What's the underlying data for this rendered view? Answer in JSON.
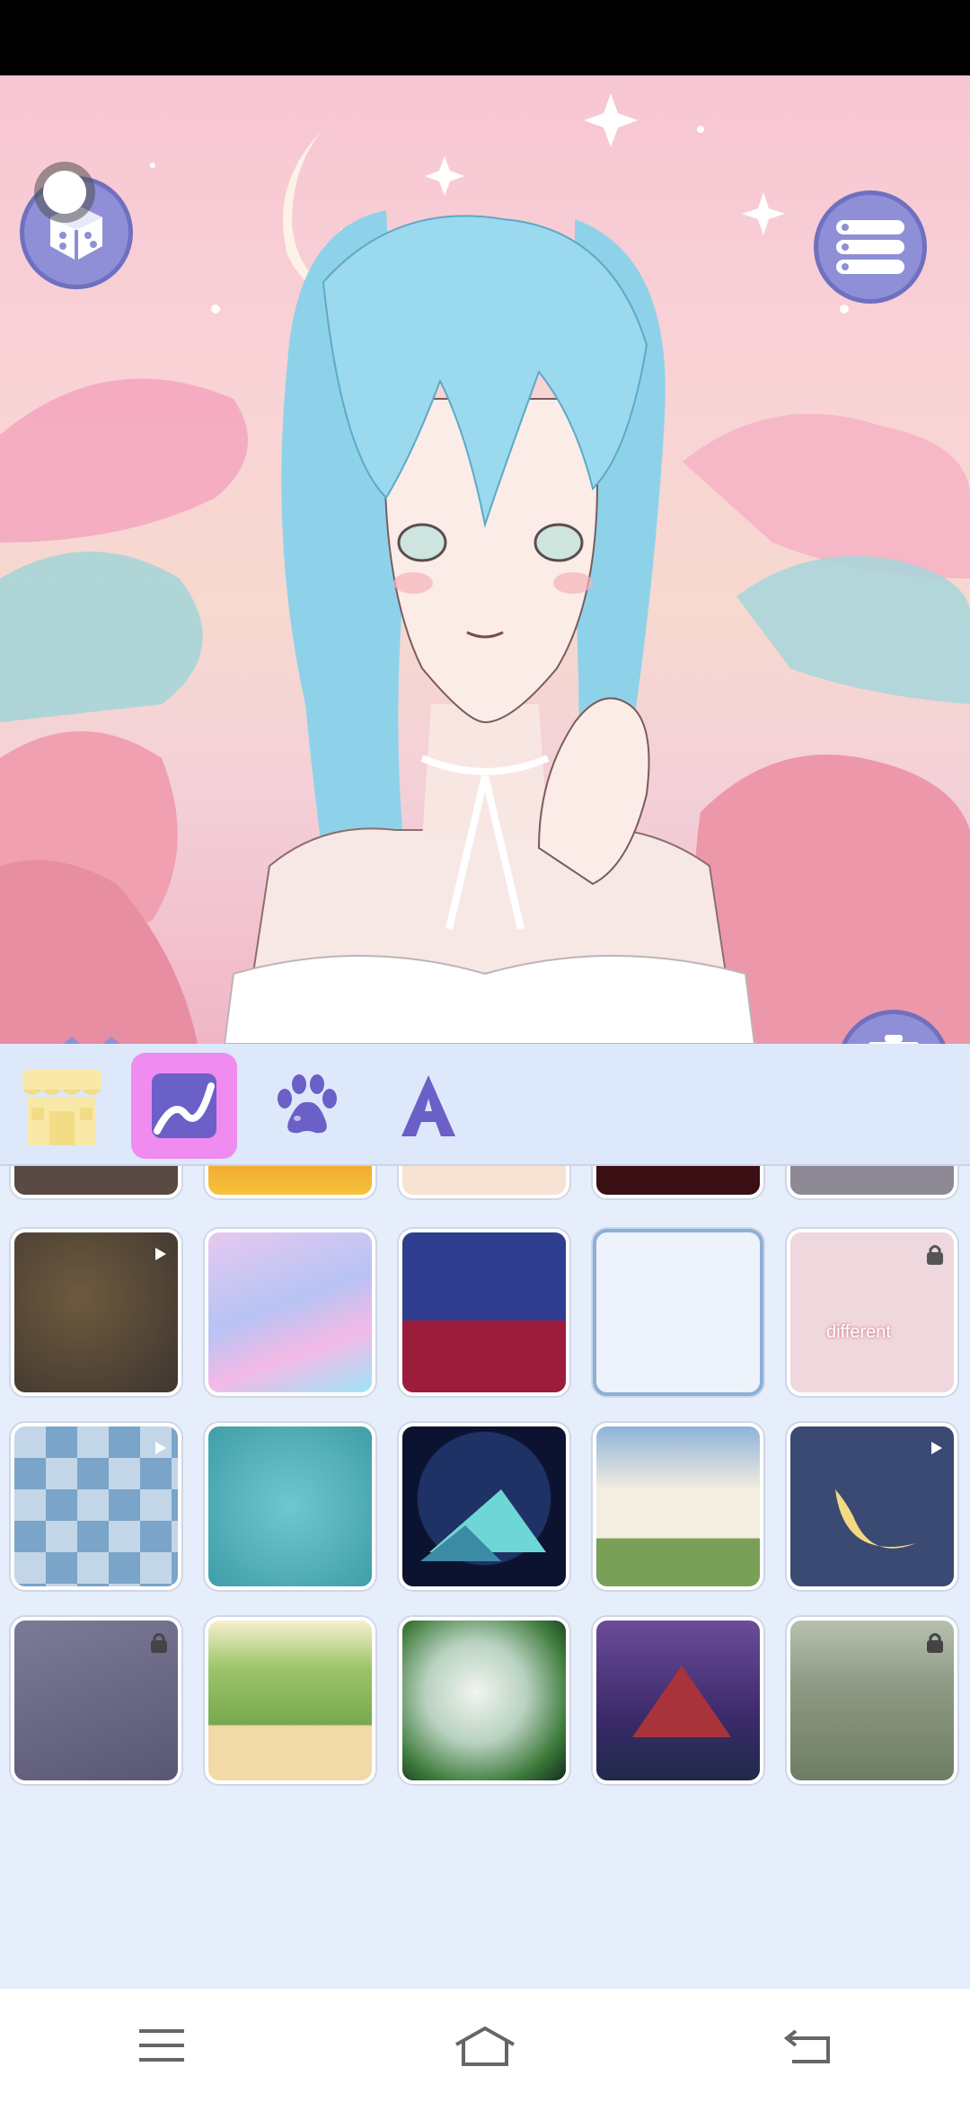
{
  "app": {
    "screen": "avatar-maker-background-picker"
  },
  "colors": {
    "accent": "#8e8fd6",
    "selected_tab": "#f08bf0",
    "panel": "#e6eefc"
  },
  "header": {
    "random_icon": "dice-icon",
    "menu_icon": "list-icon"
  },
  "preview": {
    "collapse_icon": "double-chevron-left-icon",
    "trash_icon": "trash-icon"
  },
  "tabs": [
    {
      "id": "shop",
      "icon": "shop-icon",
      "selected": false
    },
    {
      "id": "background",
      "icon": "background-icon",
      "selected": true
    },
    {
      "id": "pets",
      "icon": "paw-icon",
      "selected": false
    },
    {
      "id": "text",
      "icon": "letter-a-icon",
      "selected": false
    }
  ],
  "grid": {
    "tiles": [
      {
        "name": "dark-pattern",
        "badge": "none"
      },
      {
        "name": "fire",
        "badge": "none"
      },
      {
        "name": "peach-flowers",
        "badge": "none"
      },
      {
        "name": "red-roses",
        "badge": "none"
      },
      {
        "name": "grey-lace",
        "badge": "none"
      },
      {
        "name": "japanese-clouds-dark",
        "badge": "video"
      },
      {
        "name": "pastel-clouds",
        "badge": "none"
      },
      {
        "name": "waves-blue-red",
        "badge": "none"
      },
      {
        "name": "stationery-pattern",
        "badge": "none"
      },
      {
        "name": "cherries-pink",
        "badge": "lock"
      },
      {
        "name": "blue-checker-bows",
        "badge": "video"
      },
      {
        "name": "teal-swirls",
        "badge": "none"
      },
      {
        "name": "night-mountain",
        "badge": "none"
      },
      {
        "name": "cloudy-meadow",
        "badge": "none"
      },
      {
        "name": "crescent-moon",
        "badge": "video"
      },
      {
        "name": "grey-rays",
        "badge": "lock"
      },
      {
        "name": "grass-beach",
        "badge": "none"
      },
      {
        "name": "green-glow",
        "badge": "none"
      },
      {
        "name": "volcano-night",
        "badge": "none"
      },
      {
        "name": "misty-field",
        "badge": "lock"
      }
    ],
    "overlay_texts": {
      "cherries_tile": "different"
    }
  },
  "nav": {
    "menu_icon": "recent-apps-icon",
    "home_icon": "home-icon",
    "back_icon": "back-icon"
  }
}
